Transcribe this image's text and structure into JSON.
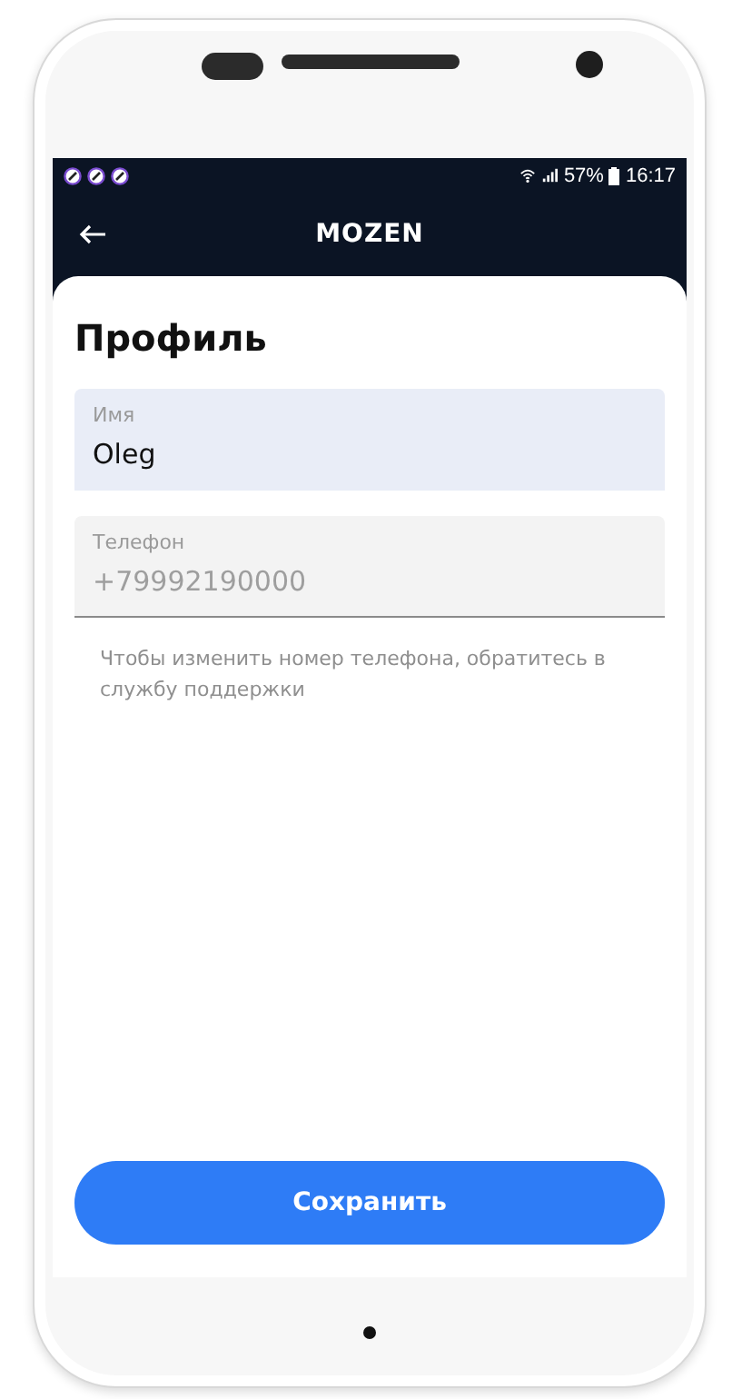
{
  "status_bar": {
    "battery": "57%",
    "time": "16:17"
  },
  "app_bar": {
    "title": "MOZEN"
  },
  "page": {
    "title": "Профиль"
  },
  "fields": [
    {
      "label": "Имя",
      "value": "Oleg",
      "disabled": false
    },
    {
      "label": "Телефон",
      "value": "+79992190000",
      "disabled": true
    }
  ],
  "hint": "Чтобы изменить номер телефона, обратитесь в службу поддержки",
  "save_button": "Сохранить"
}
